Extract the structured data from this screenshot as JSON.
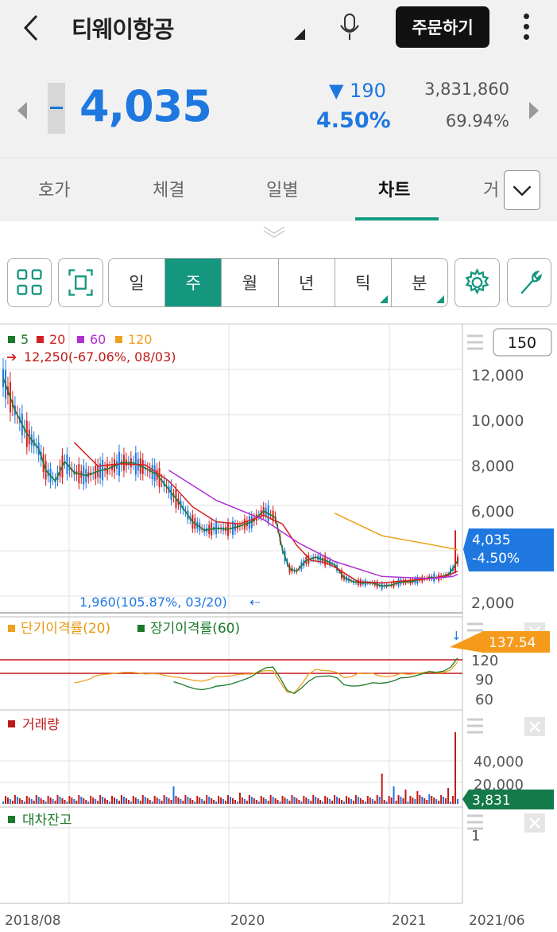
{
  "header": {
    "title": "티웨이항공",
    "order_button": "주문하기"
  },
  "quote": {
    "price": "4,035",
    "change": "▼ 190",
    "change_pct": "4.50%",
    "volume": "3,831,860",
    "volume_pct": "69.94%",
    "price_color": "#1f78e0"
  },
  "tabs": [
    {
      "label": "호가"
    },
    {
      "label": "체결"
    },
    {
      "label": "일별"
    },
    {
      "label": "차트"
    },
    {
      "label": "거"
    }
  ],
  "toolbar": {
    "periods": [
      {
        "label": "일"
      },
      {
        "label": "주"
      },
      {
        "label": "월"
      },
      {
        "label": "년"
      },
      {
        "label": "틱"
      },
      {
        "label": "분"
      }
    ],
    "active_period": "주",
    "accent": "#15967f"
  },
  "chart_data": {
    "type": "line",
    "count_box": "150",
    "legend": [
      {
        "label": "5",
        "color": "#1b7a2a"
      },
      {
        "label": "20",
        "color": "#d32020"
      },
      {
        "label": "60",
        "color": "#b030d0"
      },
      {
        "label": "120",
        "color": "#f0a020"
      }
    ],
    "high_note": "12,250(-67.06%, 08/03)",
    "low_note": "1,960(105.87%, 03/20)",
    "y_ticks": [
      "12,000",
      "10,000",
      "8,000",
      "6,000",
      "2,000"
    ],
    "ylim": [
      1500,
      13000
    ],
    "current_price_label": "4,035",
    "current_change_label": "-4.50%",
    "x_ticks": [
      "2018/08",
      "2020",
      "2021",
      "2021/06"
    ],
    "series": [
      {
        "name": "5",
        "values": [
          [
            0,
            12000
          ],
          [
            5,
            10500
          ],
          [
            10,
            9400
          ],
          [
            15,
            8700
          ],
          [
            18,
            7700
          ],
          [
            22,
            7200
          ],
          [
            26,
            8100
          ],
          [
            30,
            7600
          ],
          [
            35,
            7450
          ],
          [
            40,
            7650
          ],
          [
            45,
            7800
          ],
          [
            50,
            8050
          ],
          [
            55,
            8050
          ],
          [
            60,
            7800
          ],
          [
            65,
            7500
          ],
          [
            70,
            6800
          ],
          [
            75,
            6100
          ],
          [
            80,
            5300
          ],
          [
            85,
            4900
          ],
          [
            90,
            5000
          ],
          [
            95,
            4950
          ],
          [
            100,
            5100
          ],
          [
            105,
            5300
          ],
          [
            110,
            5800
          ],
          [
            115,
            5500
          ],
          [
            118,
            4000
          ],
          [
            121,
            3100
          ],
          [
            124,
            3000
          ],
          [
            128,
            3500
          ],
          [
            132,
            3650
          ],
          [
            136,
            3500
          ],
          [
            140,
            3300
          ],
          [
            144,
            2700
          ],
          [
            148,
            2500
          ],
          [
            152,
            2450
          ],
          [
            156,
            2450
          ],
          [
            160,
            2300
          ],
          [
            164,
            2350
          ],
          [
            168,
            2500
          ],
          [
            172,
            2500
          ],
          [
            176,
            2600
          ],
          [
            180,
            2700
          ],
          [
            184,
            2700
          ],
          [
            188,
            2850
          ],
          [
            190,
            3100
          ],
          [
            192,
            3500
          ]
        ]
      },
      {
        "name": "20",
        "values": [
          [
            30,
            9000
          ],
          [
            40,
            7900
          ],
          [
            50,
            8000
          ],
          [
            60,
            7950
          ],
          [
            70,
            7200
          ],
          [
            80,
            6000
          ],
          [
            90,
            5300
          ],
          [
            100,
            5200
          ],
          [
            110,
            5600
          ],
          [
            118,
            5200
          ],
          [
            124,
            4200
          ],
          [
            130,
            3500
          ],
          [
            136,
            3400
          ],
          [
            140,
            3200
          ],
          [
            150,
            2500
          ],
          [
            160,
            2450
          ],
          [
            170,
            2550
          ],
          [
            180,
            2650
          ],
          [
            188,
            2800
          ],
          [
            192,
            3000
          ]
        ]
      },
      {
        "name": "60",
        "values": [
          [
            70,
            7700
          ],
          [
            90,
            6300
          ],
          [
            110,
            5400
          ],
          [
            125,
            4300
          ],
          [
            140,
            3450
          ],
          [
            160,
            2750
          ],
          [
            180,
            2650
          ],
          [
            190,
            2750
          ],
          [
            192,
            2850
          ]
        ]
      },
      {
        "name": "120",
        "values": [
          [
            140,
            5700
          ],
          [
            160,
            4650
          ],
          [
            180,
            4250
          ],
          [
            192,
            4000
          ]
        ]
      }
    ],
    "disparity": {
      "title_short": "단기이격률(20)",
      "title_long": "장기이격률(60)",
      "value_label": "137.54",
      "y_ticks": [
        "120",
        "90",
        "60"
      ]
    },
    "volume_panel": {
      "title": "거래량",
      "value_label": "3,831",
      "y_ticks": [
        "40,000",
        "20,000"
      ]
    },
    "loan_panel": {
      "title": "대차잔고",
      "y_tick": "1"
    }
  }
}
